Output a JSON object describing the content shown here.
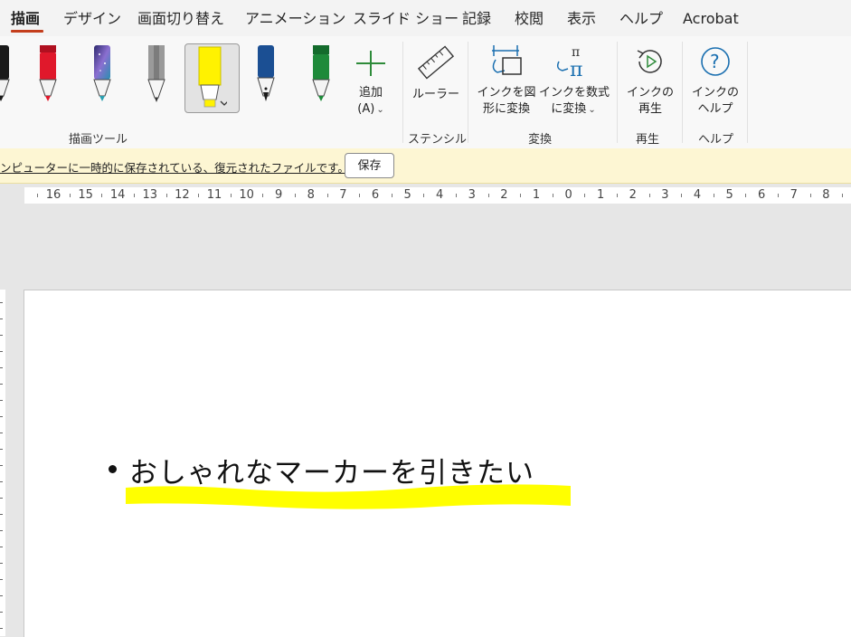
{
  "ribbon_tabs": [
    {
      "label": "描画",
      "active": true
    },
    {
      "label": "デザイン"
    },
    {
      "label": "画面切り替え"
    },
    {
      "label": "アニメーション"
    },
    {
      "label": "スライド ショー"
    },
    {
      "label": "記録"
    },
    {
      "label": "校閲"
    },
    {
      "label": "表示"
    },
    {
      "label": "ヘルプ"
    },
    {
      "label": "Acrobat"
    }
  ],
  "draw_tools": {
    "pens": [
      {
        "name": "black-pen-icon",
        "color": "#1a1a1a"
      },
      {
        "name": "red-pen-icon",
        "color": "#e0182b"
      },
      {
        "name": "galaxy-pen-icon",
        "color": "#5a4aa0"
      },
      {
        "name": "pencil-icon",
        "color": "#8a8a8a"
      },
      {
        "name": "yellow-highlighter-icon",
        "color": "#fff200",
        "selected": true
      },
      {
        "name": "blue-fountain-pen-icon",
        "color": "#1b4f93"
      },
      {
        "name": "green-pen-icon",
        "color": "#1e8a3a"
      }
    ],
    "add_label": "追加",
    "add_shortcut": "(A)",
    "group_label": "描画ツール"
  },
  "stencil": {
    "ruler_label": "ルーラー",
    "group_label": "ステンシル"
  },
  "convert": {
    "ink_to_shape_line1": "インクを図",
    "ink_to_shape_line2": "形に変換",
    "ink_to_math_line1": "インクを数式",
    "ink_to_math_line2": "に変換",
    "group_label": "変換"
  },
  "replay": {
    "line1": "インクの",
    "line2": "再生",
    "group_label": "再生"
  },
  "help": {
    "line1": "インクの",
    "line2": "ヘルプ",
    "group_label": "ヘルプ"
  },
  "infobar": {
    "message": "ンピューターに一時的に保存されている、復元されたファイルです。",
    "save_label": "保存"
  },
  "ruler": {
    "labels": [
      "16",
      "15",
      "14",
      "13",
      "12",
      "11",
      "10",
      "9",
      "8",
      "7",
      "6",
      "5",
      "4",
      "3",
      "2",
      "1",
      "0",
      "1",
      "2",
      "3",
      "4",
      "5",
      "6",
      "7",
      "8"
    ]
  },
  "slide": {
    "bullet_text": "おしゃれなマーカーを引きたい",
    "highlight_color": "#ffff00"
  }
}
